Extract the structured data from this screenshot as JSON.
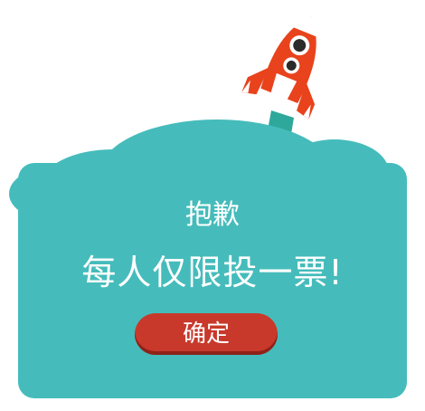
{
  "dialog": {
    "title": "抱歉",
    "message": "每人仅限投一票!",
    "confirm_label": "确定"
  },
  "icons": {
    "rocket": "rocket-icon"
  },
  "colors": {
    "panel": "#45bcbb",
    "rocket_body": "#e8431c",
    "rocket_fin": "#ffffff",
    "exhaust": "#2ea89b",
    "button": "#c8392b"
  }
}
